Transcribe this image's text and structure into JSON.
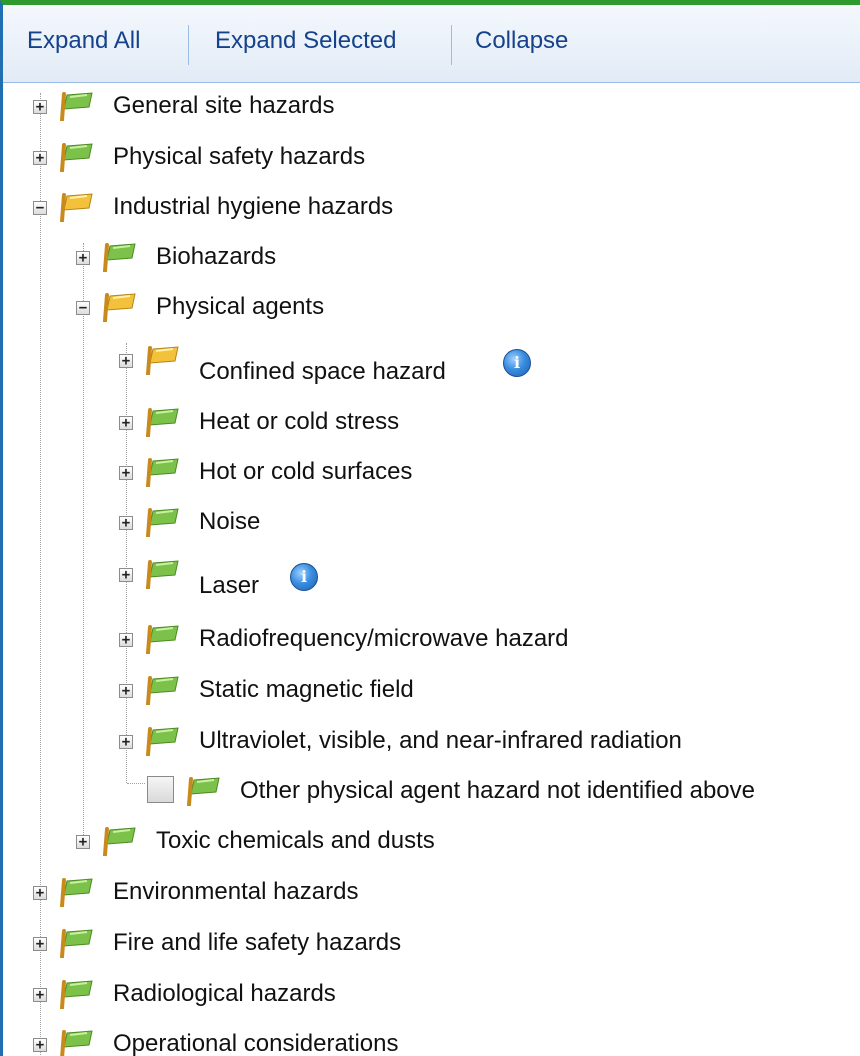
{
  "toolbar": {
    "expand_all": "Expand All",
    "expand_selected": "Expand Selected",
    "collapse": "Collapse"
  },
  "colors": {
    "flag_green": "#7cc24a",
    "flag_yellow": "#f3c23a",
    "pole": "#c98a1c",
    "link_blue": "#15428b"
  },
  "tree": [
    {
      "label": "General site hazards",
      "state": "collapsed",
      "flag": "green"
    },
    {
      "label": "Physical safety hazards",
      "state": "collapsed",
      "flag": "green"
    },
    {
      "label": "Industrial hygiene hazards",
      "state": "expanded",
      "flag": "yellow"
    },
    {
      "label": "Biohazards",
      "state": "collapsed",
      "flag": "green"
    },
    {
      "label": "Physical agents",
      "state": "expanded",
      "flag": "yellow"
    },
    {
      "label": "Confined space hazard",
      "state": "collapsed",
      "flag": "yellow",
      "info_icon": "info-icon"
    },
    {
      "label": "Heat or cold stress",
      "state": "collapsed",
      "flag": "green"
    },
    {
      "label": "Hot or cold surfaces",
      "state": "collapsed",
      "flag": "green"
    },
    {
      "label": "Noise",
      "state": "collapsed",
      "flag": "green"
    },
    {
      "label": "Laser",
      "state": "collapsed",
      "flag": "green",
      "info_icon": "info-icon"
    },
    {
      "label": "Radiofrequency/microwave hazard",
      "state": "collapsed",
      "flag": "green"
    },
    {
      "label": "Static magnetic field",
      "state": "collapsed",
      "flag": "green"
    },
    {
      "label": "Ultraviolet, visible, and near-infrared radiation",
      "state": "collapsed",
      "flag": "green"
    },
    {
      "label": "Other physical agent hazard not identified above",
      "state": "leaf",
      "flag": "green",
      "checked": false
    },
    {
      "label": "Toxic chemicals and dusts",
      "state": "collapsed",
      "flag": "green"
    },
    {
      "label": "Environmental hazards",
      "state": "collapsed",
      "flag": "green"
    },
    {
      "label": "Fire and life safety hazards",
      "state": "collapsed",
      "flag": "green"
    },
    {
      "label": "Radiological hazards",
      "state": "collapsed",
      "flag": "green"
    },
    {
      "label": "Operational considerations",
      "state": "collapsed",
      "flag": "green"
    }
  ]
}
